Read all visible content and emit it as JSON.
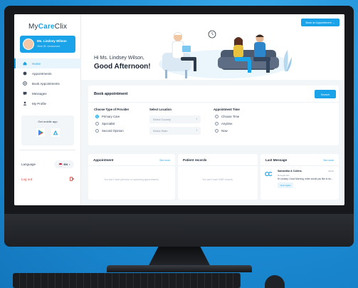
{
  "sidebar": {
    "logo_prefix": "My",
    "logo_accent": "Care",
    "logo_suffix": "Clix",
    "user_name": "Ms. Lindsey Wilson",
    "user_id": "View ID: xxxxxxxxxx",
    "nav": [
      {
        "label": "Home",
        "icon": "home-icon"
      },
      {
        "label": "Appointments",
        "icon": "calendar-icon"
      },
      {
        "label": "Book Appointments",
        "icon": "book-icon"
      },
      {
        "label": "Messages",
        "icon": "message-icon"
      },
      {
        "label": "My Profile",
        "icon": "user-icon"
      }
    ],
    "mobile_title": "Get mobile app",
    "language_label": "Language",
    "language_value": "EN",
    "logout": "Log out"
  },
  "header": {
    "cta": "Book an Appointment  →",
    "greeting": "Hi Ms. Lindsey Wilson,",
    "salutation": "Good Afternoon!"
  },
  "book": {
    "title": "Book appointment",
    "search": "Search",
    "provider_label": "Choose Type of Provider",
    "providers": [
      "Primary Care",
      "Specialist",
      "Second Opinion"
    ],
    "location_label": "Select Location",
    "country_placeholder": "Select Country",
    "state_placeholder": "Select State",
    "time_label": "Appointment Time",
    "times": [
      "Choose Time",
      "Anytime",
      "Now"
    ]
  },
  "cards": {
    "appointment": {
      "title": "Appointment",
      "link": "See more",
      "empty": "You don't have previous or upcoming appointments."
    },
    "records": {
      "title": "Patient records",
      "empty": "You don't have EMR records."
    },
    "message": {
      "title": "Last Message",
      "link": "See more",
      "avatar": "CC",
      "sender": "Samantha & Collins",
      "role": "Receptionist",
      "time": "08:32",
      "text": "Hi Lindsey, Good Morning, when would you like to do...",
      "button": "View Again"
    }
  },
  "colors": {
    "accent": "#1aa3e8",
    "logout": "#e0413a",
    "background": "#1c8fd6"
  }
}
